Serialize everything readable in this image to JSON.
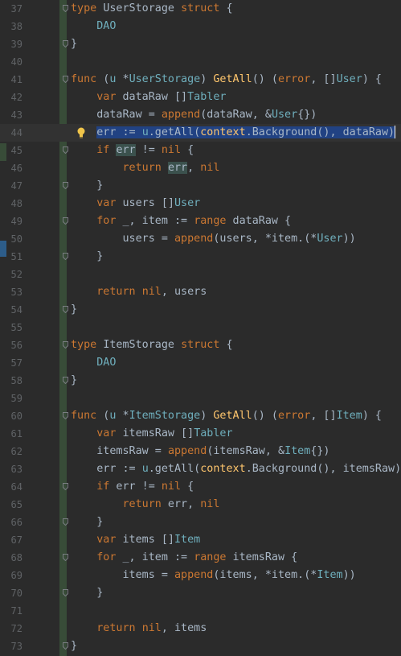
{
  "editor": {
    "lines": [
      {
        "n": "37",
        "parts": [
          {
            "t": "type",
            "c": "kw"
          },
          {
            "t": " "
          },
          {
            "t": "UserStorage",
            "c": "typ0"
          },
          {
            "t": " "
          },
          {
            "t": "struct",
            "c": "kw"
          },
          {
            "t": " {"
          }
        ]
      },
      {
        "n": "38",
        "parts": [
          {
            "t": "    "
          },
          {
            "t": "DAO",
            "c": "typ"
          }
        ]
      },
      {
        "n": "39",
        "parts": [
          {
            "t": "}"
          }
        ]
      },
      {
        "n": "40",
        "parts": []
      },
      {
        "n": "41",
        "parts": [
          {
            "t": "func",
            "c": "kw"
          },
          {
            "t": " ("
          },
          {
            "t": "u",
            "c": "recv"
          },
          {
            "t": " *"
          },
          {
            "t": "UserStorage",
            "c": "typ"
          },
          {
            "t": ") "
          },
          {
            "t": "GetAll",
            "c": "fn"
          },
          {
            "t": "() ("
          },
          {
            "t": "error",
            "c": "kw"
          },
          {
            "t": ", []"
          },
          {
            "t": "User",
            "c": "typ"
          },
          {
            "t": ") {"
          }
        ]
      },
      {
        "n": "42",
        "parts": [
          {
            "t": "    "
          },
          {
            "t": "var",
            "c": "kw"
          },
          {
            "t": " dataRaw []"
          },
          {
            "t": "Tabler",
            "c": "typ"
          }
        ]
      },
      {
        "n": "43",
        "parts": [
          {
            "t": "    dataRaw = "
          },
          {
            "t": "append",
            "c": "kw"
          },
          {
            "t": "(dataRaw, &"
          },
          {
            "t": "User",
            "c": "typ"
          },
          {
            "t": "{})"
          }
        ]
      },
      {
        "n": "44",
        "parts": [
          {
            "t": "    "
          },
          {
            "t": "err := ",
            "c": "sel"
          },
          {
            "t": "u",
            "c": "recv sel"
          },
          {
            "t": ".getAll(",
            "c": "sel"
          },
          {
            "t": "context",
            "c": "fn sel"
          },
          {
            "t": ".Background(), dataRaw)",
            "c": "sel"
          }
        ],
        "current": true,
        "bulb": true
      },
      {
        "n": "45",
        "parts": [
          {
            "t": "    "
          },
          {
            "t": "if",
            "c": "kw"
          },
          {
            "t": " "
          },
          {
            "t": "err",
            "c": "hl"
          },
          {
            "t": " != "
          },
          {
            "t": "nil",
            "c": "kw"
          },
          {
            "t": " {"
          }
        ]
      },
      {
        "n": "46",
        "parts": [
          {
            "t": "        "
          },
          {
            "t": "return",
            "c": "kw"
          },
          {
            "t": " "
          },
          {
            "t": "err",
            "c": "hl"
          },
          {
            "t": ", "
          },
          {
            "t": "nil",
            "c": "kw"
          }
        ]
      },
      {
        "n": "47",
        "parts": [
          {
            "t": "    }"
          }
        ]
      },
      {
        "n": "48",
        "parts": [
          {
            "t": "    "
          },
          {
            "t": "var",
            "c": "kw"
          },
          {
            "t": " users []"
          },
          {
            "t": "User",
            "c": "typ"
          }
        ]
      },
      {
        "n": "49",
        "parts": [
          {
            "t": "    "
          },
          {
            "t": "for",
            "c": "kw"
          },
          {
            "t": " _, item := "
          },
          {
            "t": "range",
            "c": "kw"
          },
          {
            "t": " dataRaw {"
          }
        ]
      },
      {
        "n": "50",
        "parts": [
          {
            "t": "        users = "
          },
          {
            "t": "append",
            "c": "kw"
          },
          {
            "t": "(users, *item.(*"
          },
          {
            "t": "User",
            "c": "typ"
          },
          {
            "t": "))"
          }
        ]
      },
      {
        "n": "51",
        "parts": [
          {
            "t": "    }"
          }
        ]
      },
      {
        "n": "52",
        "parts": []
      },
      {
        "n": "53",
        "parts": [
          {
            "t": "    "
          },
          {
            "t": "return",
            "c": "kw"
          },
          {
            "t": " "
          },
          {
            "t": "nil",
            "c": "kw"
          },
          {
            "t": ", users"
          }
        ]
      },
      {
        "n": "54",
        "parts": [
          {
            "t": "}"
          }
        ]
      },
      {
        "n": "55",
        "parts": []
      },
      {
        "n": "56",
        "parts": [
          {
            "t": "type",
            "c": "kw"
          },
          {
            "t": " "
          },
          {
            "t": "ItemStorage",
            "c": "typ0"
          },
          {
            "t": " "
          },
          {
            "t": "struct",
            "c": "kw"
          },
          {
            "t": " {"
          }
        ]
      },
      {
        "n": "57",
        "parts": [
          {
            "t": "    "
          },
          {
            "t": "DAO",
            "c": "typ"
          }
        ]
      },
      {
        "n": "58",
        "parts": [
          {
            "t": "}"
          }
        ]
      },
      {
        "n": "59",
        "parts": []
      },
      {
        "n": "60",
        "parts": [
          {
            "t": "func",
            "c": "kw"
          },
          {
            "t": " ("
          },
          {
            "t": "u",
            "c": "recv"
          },
          {
            "t": " *"
          },
          {
            "t": "ItemStorage",
            "c": "typ"
          },
          {
            "t": ") "
          },
          {
            "t": "GetAll",
            "c": "fn"
          },
          {
            "t": "() ("
          },
          {
            "t": "error",
            "c": "kw"
          },
          {
            "t": ", []"
          },
          {
            "t": "Item",
            "c": "typ"
          },
          {
            "t": ") {"
          }
        ]
      },
      {
        "n": "61",
        "parts": [
          {
            "t": "    "
          },
          {
            "t": "var",
            "c": "kw"
          },
          {
            "t": " itemsRaw []"
          },
          {
            "t": "Tabler",
            "c": "typ"
          }
        ]
      },
      {
        "n": "62",
        "parts": [
          {
            "t": "    itemsRaw = "
          },
          {
            "t": "append",
            "c": "kw"
          },
          {
            "t": "(itemsRaw, &"
          },
          {
            "t": "Item",
            "c": "typ"
          },
          {
            "t": "{})"
          }
        ]
      },
      {
        "n": "63",
        "parts": [
          {
            "t": "    err := "
          },
          {
            "t": "u",
            "c": "recv"
          },
          {
            "t": ".getAll("
          },
          {
            "t": "context",
            "c": "fn"
          },
          {
            "t": ".Background(), itemsRaw)"
          }
        ]
      },
      {
        "n": "64",
        "parts": [
          {
            "t": "    "
          },
          {
            "t": "if",
            "c": "kw"
          },
          {
            "t": " err != "
          },
          {
            "t": "nil",
            "c": "kw"
          },
          {
            "t": " {"
          }
        ]
      },
      {
        "n": "65",
        "parts": [
          {
            "t": "        "
          },
          {
            "t": "return",
            "c": "kw"
          },
          {
            "t": " err, "
          },
          {
            "t": "nil",
            "c": "kw"
          }
        ]
      },
      {
        "n": "66",
        "parts": [
          {
            "t": "    }"
          }
        ]
      },
      {
        "n": "67",
        "parts": [
          {
            "t": "    "
          },
          {
            "t": "var",
            "c": "kw"
          },
          {
            "t": " items []"
          },
          {
            "t": "Item",
            "c": "typ"
          }
        ]
      },
      {
        "n": "68",
        "parts": [
          {
            "t": "    "
          },
          {
            "t": "for",
            "c": "kw"
          },
          {
            "t": " _, item := "
          },
          {
            "t": "range",
            "c": "kw"
          },
          {
            "t": " itemsRaw {"
          }
        ]
      },
      {
        "n": "69",
        "parts": [
          {
            "t": "        items = "
          },
          {
            "t": "append",
            "c": "kw"
          },
          {
            "t": "(items, *item.(*"
          },
          {
            "t": "Item",
            "c": "typ"
          },
          {
            "t": "))"
          }
        ]
      },
      {
        "n": "70",
        "parts": [
          {
            "t": "    }"
          }
        ]
      },
      {
        "n": "71",
        "parts": []
      },
      {
        "n": "72",
        "parts": [
          {
            "t": "    "
          },
          {
            "t": "return",
            "c": "kw"
          },
          {
            "t": " "
          },
          {
            "t": "nil",
            "c": "kw"
          },
          {
            "t": ", items"
          }
        ]
      },
      {
        "n": "73",
        "parts": [
          {
            "t": "}"
          }
        ]
      }
    ],
    "fold_lines": [
      "37",
      "39",
      "41",
      "45",
      "47",
      "49",
      "51",
      "54",
      "56",
      "58",
      "60",
      "64",
      "66",
      "68",
      "70",
      "73"
    ],
    "colors": {
      "background": "#2b2b2b",
      "keyword": "#cc7832",
      "function": "#ffc66d",
      "type": "#6fafbd",
      "text": "#a9b7c6",
      "selection": "#214283",
      "line_number": "#606366",
      "vcs_added": "#384c38"
    }
  }
}
